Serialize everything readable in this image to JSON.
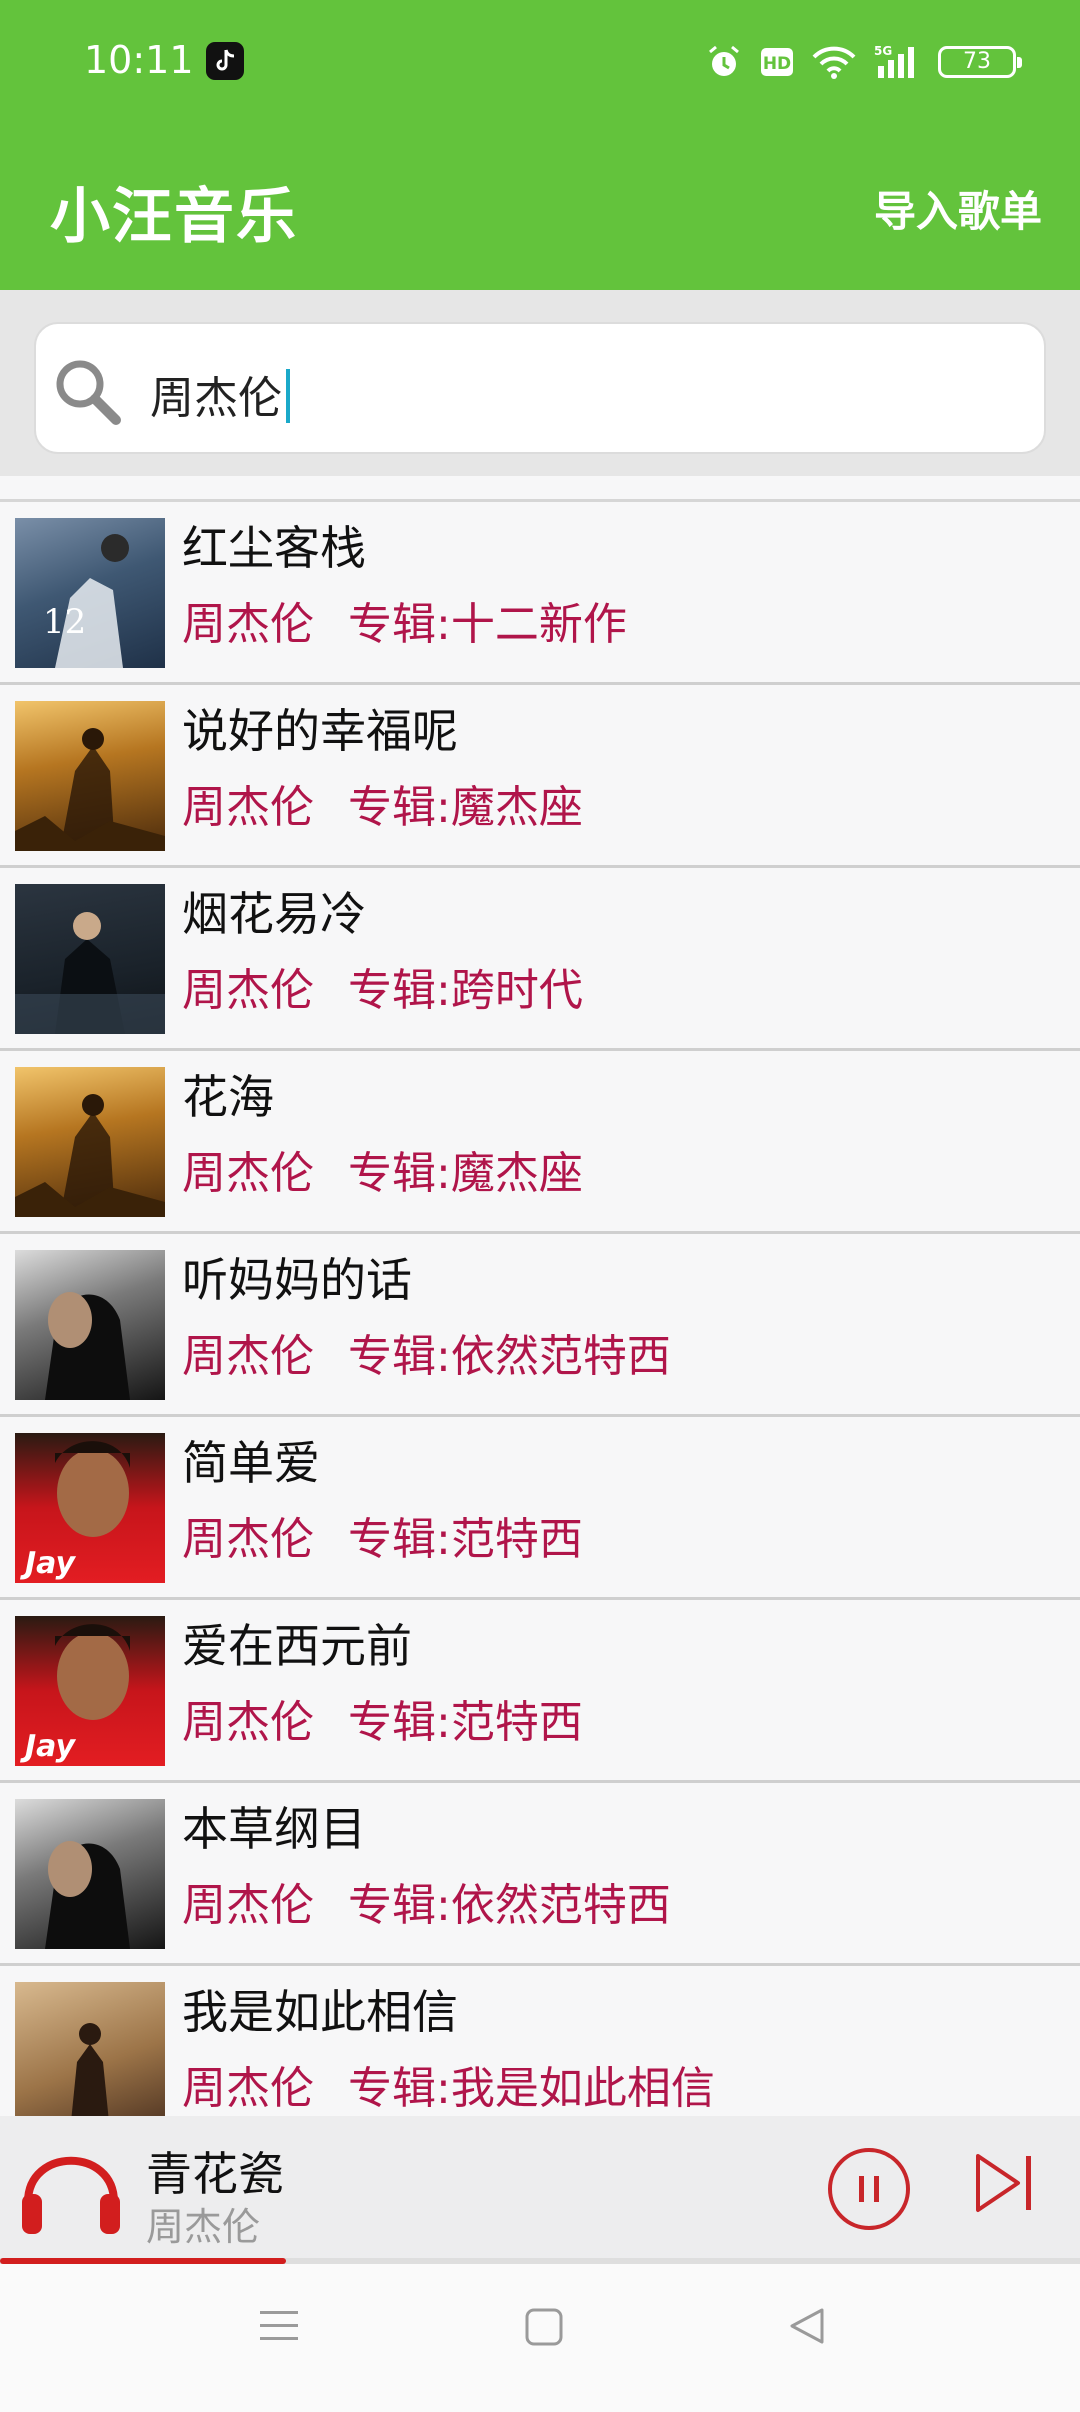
{
  "status_bar": {
    "time": "10:11",
    "battery": "73",
    "icons": [
      "tiktok-icon",
      "alarm-icon",
      "hd-icon",
      "wifi-icon",
      "signal-5g-icon",
      "battery-icon"
    ]
  },
  "app_bar": {
    "title": "小汪音乐",
    "import_label": "导入歌单"
  },
  "search": {
    "value": "周杰伦",
    "icon": "search-icon"
  },
  "songs": [
    {
      "title": "红尘客栈",
      "artist": "周杰伦",
      "album": "专辑:十二新作"
    },
    {
      "title": "说好的幸福呢",
      "artist": "周杰伦",
      "album": "专辑:魔杰座"
    },
    {
      "title": "烟花易冷",
      "artist": "周杰伦",
      "album": "专辑:跨时代"
    },
    {
      "title": "花海",
      "artist": "周杰伦",
      "album": "专辑:魔杰座"
    },
    {
      "title": "听妈妈的话",
      "artist": "周杰伦",
      "album": "专辑:依然范特西"
    },
    {
      "title": "简单爱",
      "artist": "周杰伦",
      "album": "专辑:范特西"
    },
    {
      "title": "爱在西元前",
      "artist": "周杰伦",
      "album": "专辑:范特西"
    },
    {
      "title": "本草纲目",
      "artist": "周杰伦",
      "album": "专辑:依然范特西"
    },
    {
      "title": "我是如此相信",
      "artist": "周杰伦",
      "album": "专辑:我是如此相信"
    }
  ],
  "now_playing": {
    "title": "青花瓷",
    "artist": "周杰伦",
    "progress": 0.265
  },
  "colors": {
    "accent_green": "#63c33c",
    "meta_red": "#b0154a",
    "player_red": "#d21e1e"
  }
}
